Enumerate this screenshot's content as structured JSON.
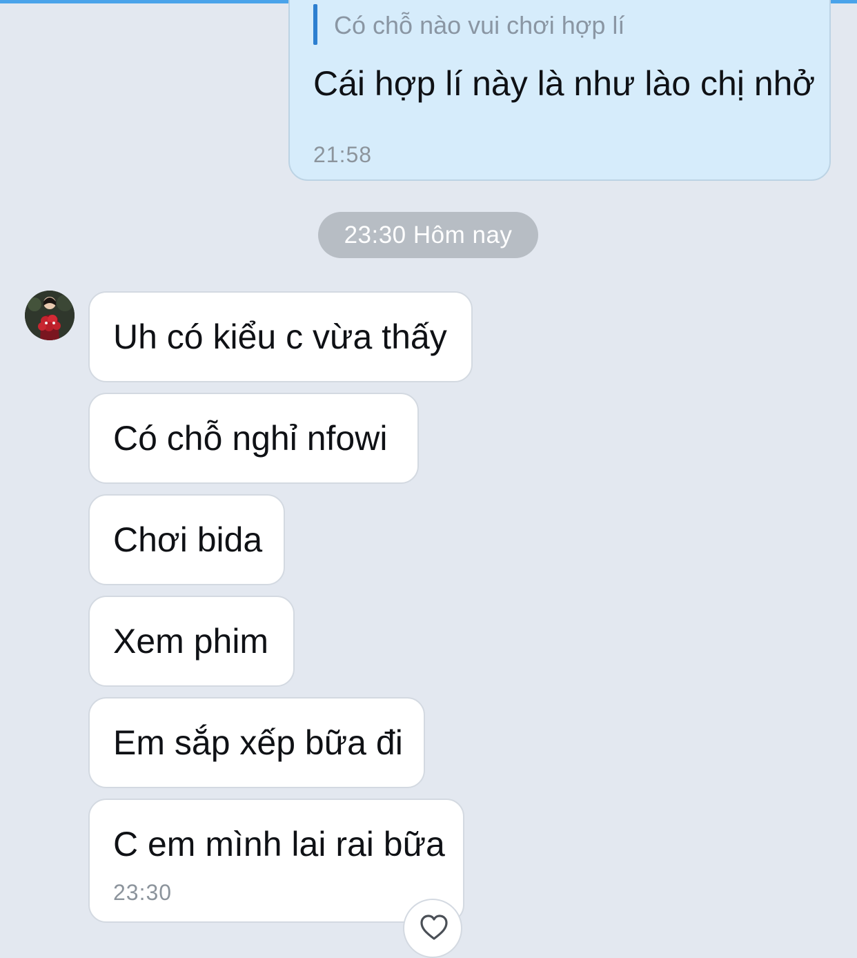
{
  "colors": {
    "background": "#e3e8f0",
    "sent_bubble": "#d6ecfb",
    "received_bubble": "#ffffff",
    "quote_bar": "#2d7fd0",
    "date_pill": "#b7bdc4",
    "accent_top": "#4aa3ea"
  },
  "sent_message": {
    "quote": "Có chỗ nào vui chơi hợp lí",
    "text": "Cái hợp lí này là như lào chị nhở",
    "time": "21:58"
  },
  "date_separator": "23:30 Hôm nay",
  "received_messages": [
    {
      "text": "Uh có kiểu c vừa thấy"
    },
    {
      "text": "Có chỗ nghỉ nfowi"
    },
    {
      "text": "Chơi bida"
    },
    {
      "text": "Xem phim"
    },
    {
      "text": "Em sắp xếp bữa đi"
    },
    {
      "text": "C em mình lai rai bữa",
      "time": "23:30"
    }
  ],
  "icons": {
    "avatar": "contact-avatar",
    "reaction": "heart-icon"
  }
}
